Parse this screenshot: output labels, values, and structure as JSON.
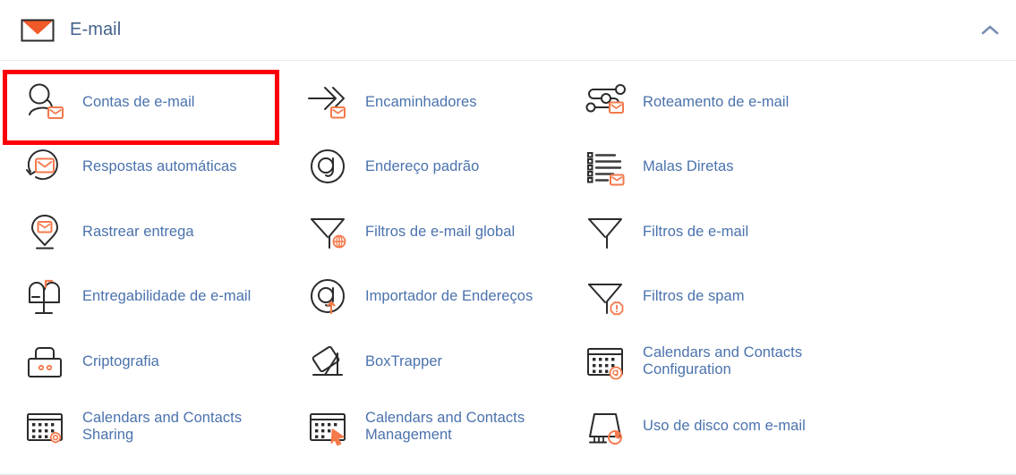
{
  "header": {
    "title": "E-mail",
    "icon": "envelope-icon",
    "collapse_icon": "chevron-up-icon",
    "collapsed": false
  },
  "colors": {
    "link": "#4a72ad",
    "title": "#44628a",
    "accent_orange": "#f4794b",
    "envelope_orange": "#f05a28",
    "icon_stroke": "#2b2b2b",
    "highlight": "#fb0007",
    "divider": "#e7eaec"
  },
  "highlight": {
    "target": "Contas de e-mail",
    "color": "#fb0007"
  },
  "items": [
    {
      "label": "Contas de e-mail",
      "icon": "user-mail-icon",
      "highlighted": true
    },
    {
      "label": "Encaminhadores",
      "icon": "forwarders-arrow-icon",
      "highlighted": false
    },
    {
      "label": "Roteamento de e-mail",
      "icon": "routing-nodes-icon",
      "highlighted": false
    },
    {
      "label": "Respostas automáticas",
      "icon": "autoresponder-icon",
      "highlighted": false
    },
    {
      "label": "Endereço padrão",
      "icon": "at-sign-icon",
      "highlighted": false
    },
    {
      "label": "Malas Diretas",
      "icon": "mailing-list-icon",
      "highlighted": false
    },
    {
      "label": "Rastrear entrega",
      "icon": "track-delivery-pin-icon",
      "highlighted": false
    },
    {
      "label": "Filtros de e-mail global",
      "icon": "global-filter-icon",
      "highlighted": false
    },
    {
      "label": "Filtros de e-mail",
      "icon": "filter-icon",
      "highlighted": false
    },
    {
      "label": "Entregabilidade de e-mail",
      "icon": "mailbox-icon",
      "highlighted": false
    },
    {
      "label": "Importador de Endereços",
      "icon": "address-importer-icon",
      "highlighted": false
    },
    {
      "label": "Filtros de spam",
      "icon": "spam-filter-icon",
      "highlighted": false
    },
    {
      "label": "Criptografia",
      "icon": "lock-icon",
      "highlighted": false
    },
    {
      "label": "BoxTrapper",
      "icon": "boxtrapper-icon",
      "highlighted": false
    },
    {
      "label": "Calendars and Contacts Configuration",
      "icon": "calendar-at-icon",
      "highlighted": false
    },
    {
      "label": "Calendars and Contacts Sharing",
      "icon": "calendar-gear-icon",
      "highlighted": false
    },
    {
      "label": "Calendars and Contacts Management",
      "icon": "calendar-cursor-icon",
      "highlighted": false
    },
    {
      "label": "Uso de disco com e-mail",
      "icon": "disk-usage-icon",
      "highlighted": false
    }
  ]
}
